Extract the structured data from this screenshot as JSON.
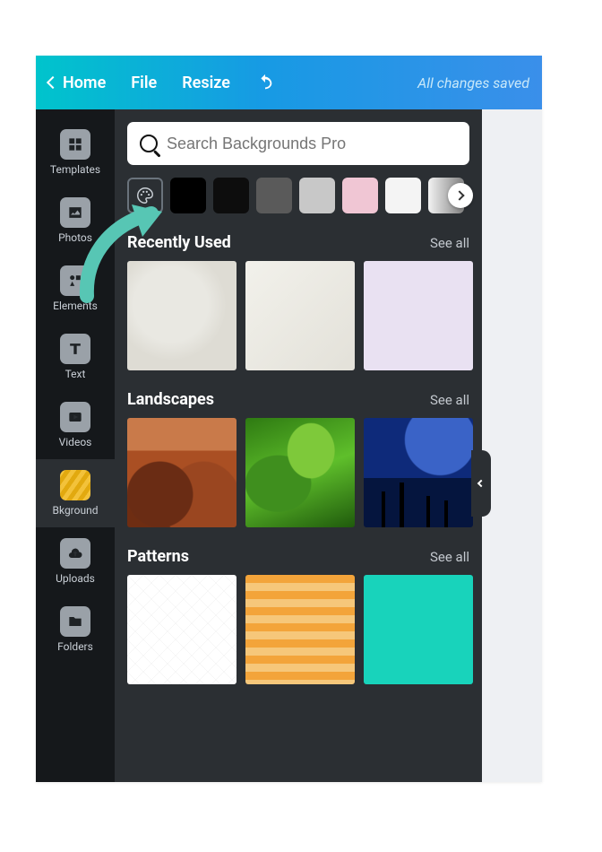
{
  "header": {
    "home_label": "Home",
    "file_label": "File",
    "resize_label": "Resize",
    "saved_label": "All changes saved"
  },
  "sidebar": {
    "items": [
      {
        "label": "Templates"
      },
      {
        "label": "Photos"
      },
      {
        "label": "Elements"
      },
      {
        "label": "Text"
      },
      {
        "label": "Videos"
      },
      {
        "label": "Bkground"
      },
      {
        "label": "Uploads"
      },
      {
        "label": "Folders"
      }
    ]
  },
  "search": {
    "placeholder": "Search Backgrounds Pro"
  },
  "swatches": [
    "#000000",
    "#0d0d0d",
    "#5a5a5a",
    "#c8c8c8",
    "#f0c6d4",
    "#f4f4f4"
  ],
  "sections": {
    "recent": {
      "title": "Recently Used",
      "seeall": "See all"
    },
    "landscapes": {
      "title": "Landscapes",
      "seeall": "See all"
    },
    "patterns": {
      "title": "Patterns",
      "seeall": "See all"
    }
  }
}
